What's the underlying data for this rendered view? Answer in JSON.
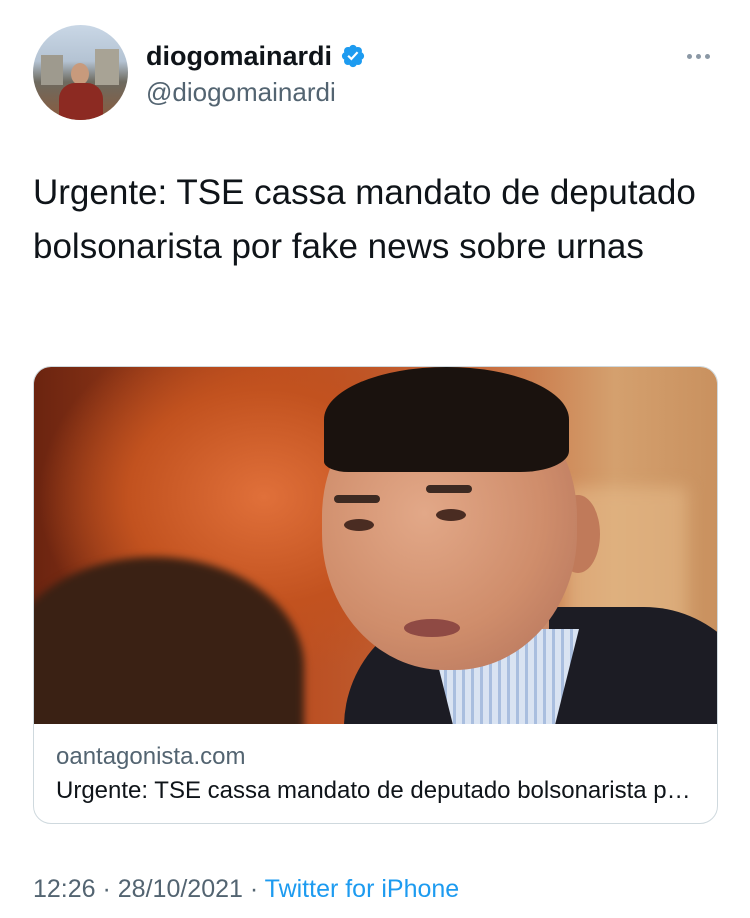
{
  "author": {
    "display_name": "diogomainardi",
    "handle": "@diogomainardi",
    "verified": true
  },
  "icons": {
    "avatar": "profile-photo",
    "verified": "verified-badge-icon",
    "more": "more-options-icon"
  },
  "tweet": {
    "text": "Urgente: TSE cassa mandato de deputado bolsonarista por fake news sobre urnas"
  },
  "card": {
    "image": "man-in-suit-photo",
    "domain": "oantagonista.com",
    "title": "Urgente: TSE cassa mandato de deputado bolsonarista por fake news sobre urnas"
  },
  "meta": {
    "time": "12:26",
    "separator_1": " · ",
    "date": "28/10/2021",
    "separator_2": " · ",
    "source": "Twitter for iPhone"
  },
  "colors": {
    "text_primary": "#0f1419",
    "text_secondary": "#536471",
    "accent": "#1d9bf0",
    "border": "#cfd9de"
  }
}
